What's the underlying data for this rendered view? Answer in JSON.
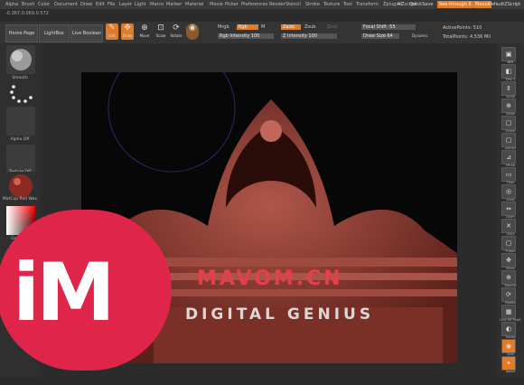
{
  "menu": [
    "Alpha",
    "Brush",
    "Color",
    "Document",
    "Draw",
    "Edit",
    "File",
    "Layer",
    "Light",
    "Macro",
    "Marker",
    "Material",
    "Movie",
    "Picker",
    "Preferences",
    "Render",
    "Stencil",
    "Stroke",
    "Texture",
    "Tool",
    "Transform",
    "Zplugin",
    "Zscript"
  ],
  "menu_right": {
    "ac": "AC",
    "quicksave": "QuickSave",
    "see_through": "See-through 0",
    "menus": "Menus",
    "default_script": "DefaultZScript"
  },
  "coords": "-0.367,0.069,0.572",
  "topbar": {
    "home_page": "Home Page",
    "lightbox": "LightBox",
    "live_boolean": "Live Boolean",
    "tools": [
      {
        "label": "Edit",
        "glyph": "✎",
        "active": true
      },
      {
        "label": "Draw",
        "glyph": "✥",
        "active": true
      },
      {
        "label": "Move",
        "glyph": "⊕",
        "active": false
      },
      {
        "label": "Scale",
        "glyph": "⊡",
        "active": false
      },
      {
        "label": "Rotate",
        "glyph": "⟳",
        "active": false
      }
    ],
    "mrgb": "Mrgb",
    "rgb": "Rgb",
    "m": "M",
    "zadd": "Zadd",
    "zsub": "Zsub",
    "zcut": "Zcut",
    "rgb_intensity": "Rgb Intensity 100",
    "z_intensity": "Z Intensity 100",
    "focal_shift": "Focal Shift -55",
    "draw_size": "Draw Size 64",
    "dynamic": "Dynamic",
    "active_points": "ActivePoints: 510",
    "total_points": "TotalPoints: 4.536 Mil"
  },
  "left": {
    "smooth": "Smooth",
    "dots": "Dots",
    "alpha_off": "Alpha Off",
    "texture_off": "Texture Off",
    "matcap": "MatCap Red Wax",
    "gradient": "Gradient"
  },
  "right": {
    "icons": [
      {
        "label": "BPR",
        "glyph": "▣"
      },
      {
        "label": "SPix 3",
        "glyph": "◧"
      },
      {
        "label": "Scroll",
        "glyph": "⇕"
      },
      {
        "label": "Zoom",
        "glyph": "⊕"
      },
      {
        "label": "Actual",
        "glyph": "▢"
      },
      {
        "label": "AAHalf",
        "glyph": "▢"
      },
      {
        "label": "Persp",
        "glyph": "⊿"
      },
      {
        "label": "Floor",
        "glyph": "▭"
      },
      {
        "label": "Local",
        "glyph": "◎"
      },
      {
        "label": "Lsym",
        "glyph": "⇔"
      },
      {
        "label": "Gxyz",
        "glyph": "✕"
      },
      {
        "label": "Frame",
        "glyph": "▢"
      },
      {
        "label": "Move",
        "glyph": "✥"
      },
      {
        "label": "ZoomD",
        "glyph": "⊕"
      },
      {
        "label": "Rotate",
        "glyph": "⟳"
      },
      {
        "label": "Line Fill PolyF",
        "glyph": "▦"
      },
      {
        "label": "Transp",
        "glyph": "◐"
      },
      {
        "label": "Solo",
        "glyph": "◉"
      },
      {
        "label": "Xpose",
        "glyph": "✦"
      }
    ]
  },
  "watermark": {
    "site": "MAVOM.CN",
    "tagline": "DIGITAL GENIUS",
    "logo": "iM"
  },
  "colors": {
    "accent": "#e07b2a",
    "model": "#8a3a2e",
    "logo": "#e0254a"
  }
}
